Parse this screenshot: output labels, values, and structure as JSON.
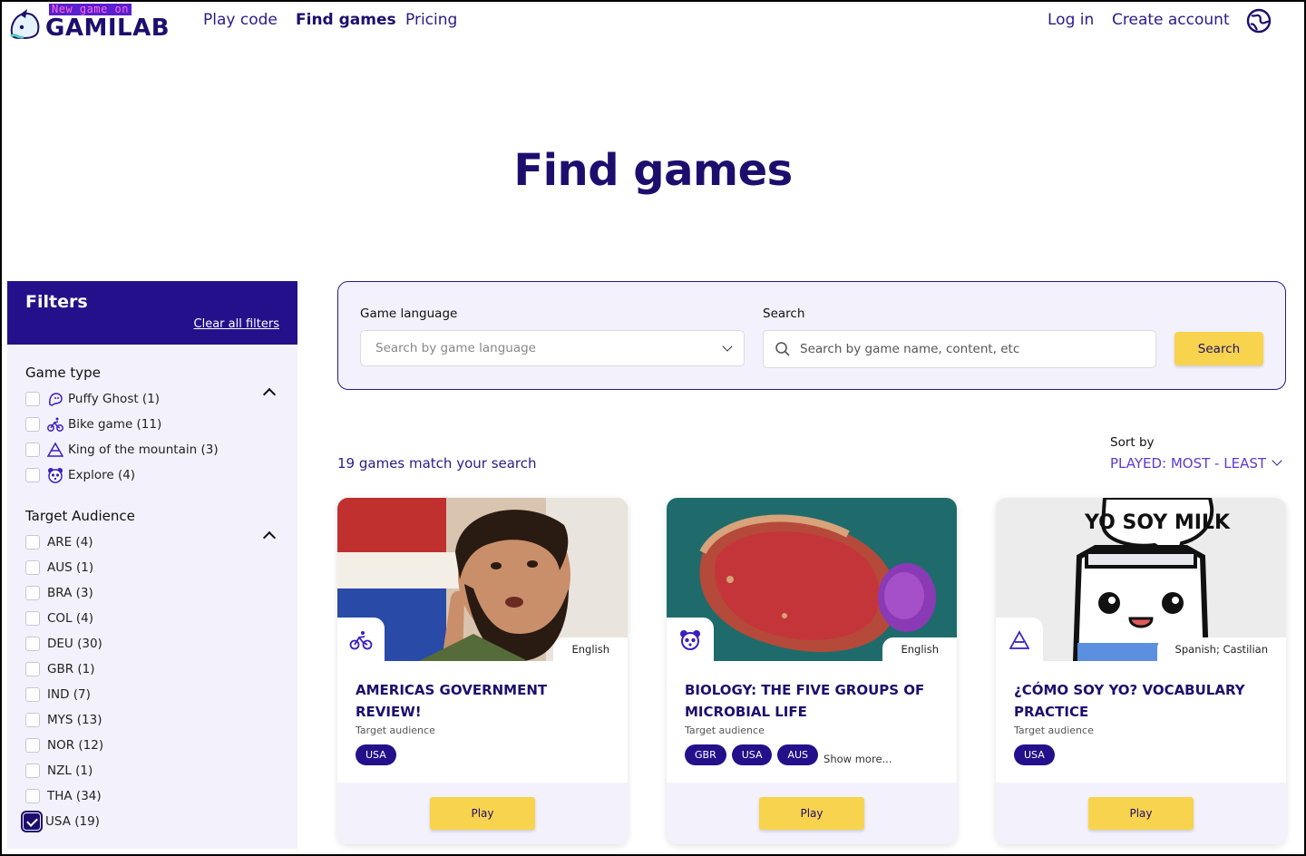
{
  "brand": {
    "badge": "New game on",
    "name": "GAMILAB"
  },
  "nav": {
    "play_code": "Play code",
    "find_games": "Find games",
    "pricing": "Pricing",
    "log_in": "Log in",
    "create_account": "Create account"
  },
  "page_title": "Find games",
  "filters": {
    "title": "Filters",
    "clear_all": "Clear all filters",
    "game_type": {
      "heading": "Game type",
      "items": [
        {
          "label": "Puffy Ghost (1)",
          "icon": "ghost-icon",
          "checked": false
        },
        {
          "label": "Bike game (11)",
          "icon": "bike-icon",
          "checked": false
        },
        {
          "label": "King of the mountain (3)",
          "icon": "mountain-icon",
          "checked": false
        },
        {
          "label": "Explore (4)",
          "icon": "panda-icon",
          "checked": false
        }
      ]
    },
    "target_audience": {
      "heading": "Target Audience",
      "items": [
        {
          "label": "ARE (4)",
          "checked": false
        },
        {
          "label": "AUS (1)",
          "checked": false
        },
        {
          "label": "BRA (3)",
          "checked": false
        },
        {
          "label": "COL (4)",
          "checked": false
        },
        {
          "label": "DEU (30)",
          "checked": false
        },
        {
          "label": "GBR (1)",
          "checked": false
        },
        {
          "label": "IND (7)",
          "checked": false
        },
        {
          "label": "MYS (13)",
          "checked": false
        },
        {
          "label": "NOR (12)",
          "checked": false
        },
        {
          "label": "NZL (1)",
          "checked": false
        },
        {
          "label": "THA (34)",
          "checked": false
        },
        {
          "label": "USA (19)",
          "checked": true
        }
      ]
    }
  },
  "search": {
    "language_label": "Game language",
    "language_placeholder": "Search by game language",
    "search_label": "Search",
    "search_placeholder": "Search by game name, content, etc",
    "search_button": "Search"
  },
  "results": {
    "count_text": "19 games match your search",
    "sort_label": "Sort by",
    "sort_value": "PLAYED: MOST - LEAST"
  },
  "cards": [
    {
      "title": "AMERICAS GOVERNMENT REVIEW!",
      "language": "English",
      "type_icon": "bike-icon",
      "audience_label": "Target audience",
      "tags": [
        "USA"
      ],
      "show_more": "",
      "play": "Play"
    },
    {
      "title": "BIOLOGY: THE FIVE GROUPS OF MICROBIAL LIFE",
      "language": "English",
      "type_icon": "panda-icon",
      "audience_label": "Target audience",
      "tags": [
        "GBR",
        "USA",
        "AUS"
      ],
      "show_more": "Show more...",
      "play": "Play"
    },
    {
      "title": "¿CÓMO SOY YO? VOCABULARY PRACTICE",
      "language": "Spanish; Castilian",
      "type_icon": "mountain-icon",
      "audience_label": "Target audience",
      "tags": [
        "USA"
      ],
      "show_more": "",
      "play": "Play",
      "image_text": "YO SOY MILK"
    }
  ],
  "colors": {
    "primary": "#1d0e6e",
    "accent_yellow": "#f8d34d",
    "panel_bg": "#f3f1fb"
  }
}
